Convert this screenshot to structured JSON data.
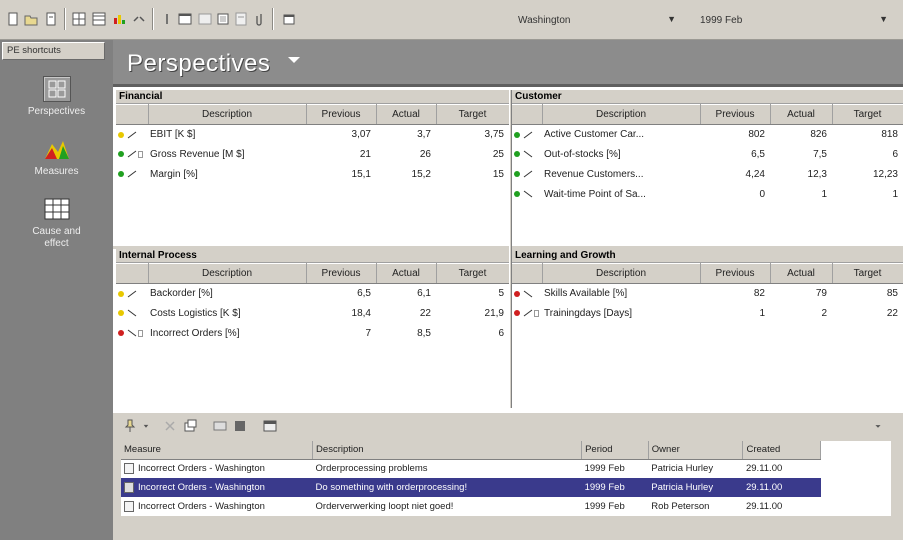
{
  "toolbar": {
    "location": "Washington",
    "period": "1999 Feb"
  },
  "left_pane": {
    "tab_label": "PE shortcuts",
    "shortcuts": [
      {
        "label": "Perspectives",
        "icon": "perspectives-icon"
      },
      {
        "label": "Measures",
        "icon": "measures-icon"
      },
      {
        "label": "Cause and effect",
        "icon": "cause-effect-icon"
      }
    ]
  },
  "main": {
    "title": "Perspectives",
    "columns": {
      "description": "Description",
      "previous": "Previous",
      "actual": "Actual",
      "target": "Target"
    },
    "panels": {
      "financial": {
        "title": "Financial",
        "rows": [
          {
            "status": "yellow",
            "trend": "up",
            "note": false,
            "description": "EBIT [K $]",
            "previous": "3,07",
            "actual": "3,7",
            "target": "3,75"
          },
          {
            "status": "green",
            "trend": "up",
            "note": true,
            "description": "Gross Revenue [M $]",
            "previous": "21",
            "actual": "26",
            "target": "25"
          },
          {
            "status": "green",
            "trend": "up",
            "note": false,
            "description": "Margin [%]",
            "previous": "15,1",
            "actual": "15,2",
            "target": "15"
          }
        ]
      },
      "customer": {
        "title": "Customer",
        "rows": [
          {
            "status": "green",
            "trend": "up",
            "note": false,
            "description": "Active Customer Car...",
            "previous": "802",
            "actual": "826",
            "target": "818"
          },
          {
            "status": "green",
            "trend": "down",
            "note": false,
            "description": "Out-of-stocks [%]",
            "previous": "6,5",
            "actual": "7,5",
            "target": "6"
          },
          {
            "status": "green",
            "trend": "up",
            "note": false,
            "description": "Revenue Customers...",
            "previous": "4,24",
            "actual": "12,3",
            "target": "12,23"
          },
          {
            "status": "green",
            "trend": "down",
            "note": false,
            "description": "Wait-time Point of Sa...",
            "previous": "0",
            "actual": "1",
            "target": "1"
          }
        ]
      },
      "internal": {
        "title": "Internal Process",
        "rows": [
          {
            "status": "yellow",
            "trend": "up",
            "note": false,
            "description": "Backorder [%]",
            "previous": "6,5",
            "actual": "6,1",
            "target": "5"
          },
          {
            "status": "yellow",
            "trend": "down",
            "note": false,
            "description": "Costs Logistics [K $]",
            "previous": "18,4",
            "actual": "22",
            "target": "21,9"
          },
          {
            "status": "red",
            "trend": "down",
            "note": true,
            "description": "Incorrect Orders [%]",
            "previous": "7",
            "actual": "8,5",
            "target": "6"
          }
        ]
      },
      "learning": {
        "title": "Learning and Growth",
        "rows": [
          {
            "status": "red",
            "trend": "down",
            "note": false,
            "description": "Skills Available [%]",
            "previous": "82",
            "actual": "79",
            "target": "85"
          },
          {
            "status": "red",
            "trend": "up",
            "note": true,
            "description": "Trainingdays [Days]",
            "previous": "1",
            "actual": "2",
            "target": "22"
          }
        ]
      }
    }
  },
  "messages": {
    "columns": {
      "measure": "Measure",
      "description": "Description",
      "period": "Period",
      "owner": "Owner",
      "created": "Created"
    },
    "rows": [
      {
        "measure": "Incorrect Orders - Washington",
        "description": "Orderprocessing problems",
        "period": "1999 Feb",
        "owner": "Patricia Hurley",
        "created": "29.11.00"
      },
      {
        "measure": "Incorrect Orders - Washington",
        "description": "Do something with orderprocessing!",
        "period": "1999 Feb",
        "owner": "Patricia Hurley",
        "created": "29.11.00"
      },
      {
        "measure": "Incorrect Orders - Washington",
        "description": "Orderverwerking loopt niet goed!",
        "period": "1999 Feb",
        "owner": "Rob Peterson",
        "created": "29.11.00"
      }
    ]
  },
  "colors": {
    "status_green": "#20a020",
    "status_yellow": "#e8c800",
    "status_red": "#d02020",
    "selection": "#3a3a8c"
  }
}
